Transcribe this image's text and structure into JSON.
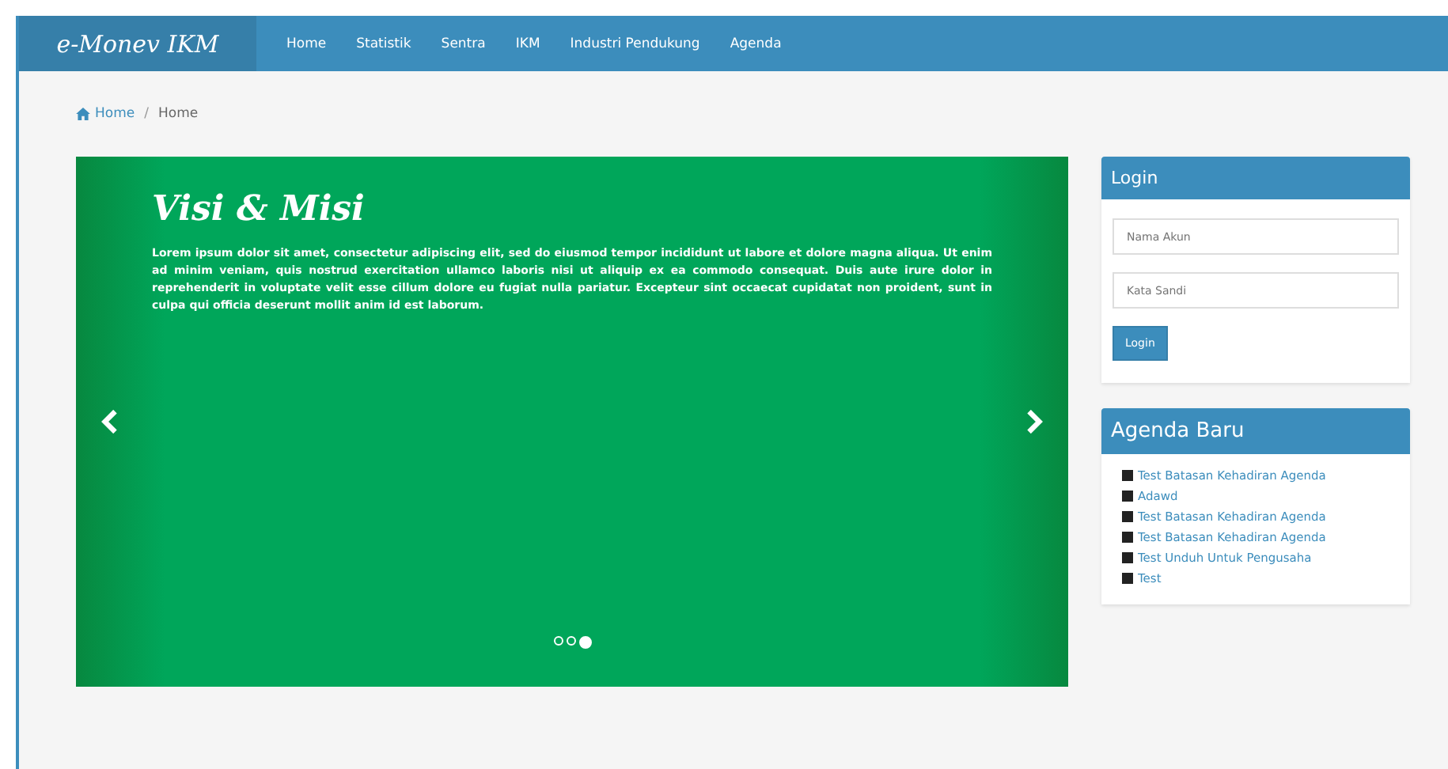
{
  "navbar": {
    "brand": "e-Monev IKM",
    "items": [
      {
        "label": "Home"
      },
      {
        "label": "Statistik"
      },
      {
        "label": "Sentra"
      },
      {
        "label": "IKM"
      },
      {
        "label": "Industri Pendukung"
      },
      {
        "label": "Agenda"
      }
    ]
  },
  "breadcrumb": [
    "Home",
    "/",
    "Home"
  ],
  "carousel": {
    "title": "Visi & Misi",
    "text": "Lorem ipsum dolor sit amet, consectetur adipiscing elit, sed do eiusmod tempor incididunt ut labore et dolore magna aliqua. Ut enim ad minim veniam, quis nostrud exercitation ullamco laboris nisi ut aliquip ex ea commodo consequat. Duis aute irure dolor in reprehenderit in voluptate velit esse cillum dolore eu fugiat nulla pariatur. Excepteur sint occaecat cupidatat non proident, sunt in culpa qui officia deserunt mollit anim id est laborum.",
    "indicators": [
      {
        "selected": false
      },
      {
        "selected": false
      },
      {
        "selected": true
      }
    ]
  },
  "login": {
    "title": "Login",
    "username": {
      "placeholder": "Nama Akun"
    },
    "password": {
      "placeholder": "Kata Sandi"
    },
    "button": "Login"
  },
  "agenda": {
    "title": "Agenda Baru",
    "items": [
      "Test Batasan Kehadiran Agenda",
      "Adawd",
      "Test Batasan Kehadiran Agenda",
      "Test Batasan Kehadiran Agenda",
      "Test Unduh Untuk Pengusaha",
      "Test"
    ]
  }
}
